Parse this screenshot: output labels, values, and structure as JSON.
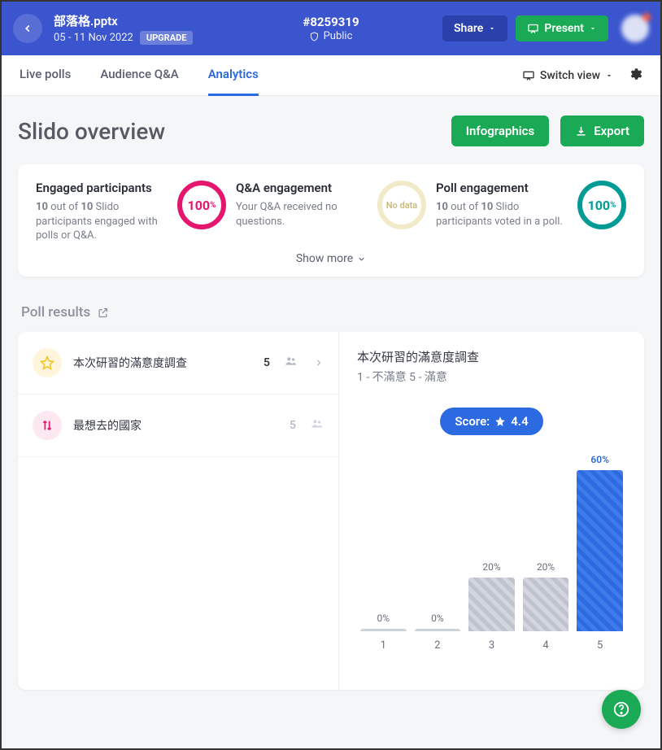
{
  "header": {
    "file_title": "部落格.pptx",
    "date_range": "05 - 11 Nov 2022",
    "upgrade_label": "UPGRADE",
    "event_id": "#8259319",
    "visibility": "Public",
    "share_label": "Share",
    "present_label": "Present"
  },
  "tabs": {
    "live_polls": "Live polls",
    "audience_qa": "Audience Q&A",
    "analytics": "Analytics",
    "switch_view": "Switch view"
  },
  "page": {
    "title": "Slido overview",
    "infographics_label": "Infographics",
    "export_label": "Export"
  },
  "overview": {
    "engaged": {
      "title": "Engaged participants",
      "desc_pre": "10",
      "desc_mid": " out of ",
      "desc_bold2": "10",
      "desc_post": " Slido participants engaged with polls or Q&A.",
      "ring": "100",
      "ring_unit": "%"
    },
    "qa": {
      "title": "Q&A engagement",
      "desc": "Your Q&A received no questions.",
      "ring": "No data"
    },
    "poll": {
      "title": "Poll engagement",
      "desc_pre": "10",
      "desc_mid": " out of ",
      "desc_bold2": "10",
      "desc_post": " Slido participants voted in a poll.",
      "ring": "100",
      "ring_unit": "%"
    },
    "show_more": "Show more"
  },
  "poll_results": {
    "header": "Poll results",
    "items": [
      {
        "name": "本次研習的滿意度調查",
        "count": "5"
      },
      {
        "name": "最想去的國家",
        "count": "5"
      }
    ],
    "detail": {
      "title": "本次研習的滿意度調查",
      "subtitle": "1 - 不滿意   5 - 滿意",
      "score_label": "Score:",
      "score_value": "4.4"
    }
  },
  "chart_data": {
    "type": "bar",
    "categories": [
      "1",
      "2",
      "3",
      "4",
      "5"
    ],
    "values": [
      0,
      0,
      20,
      20,
      60
    ],
    "value_labels": [
      "0%",
      "0%",
      "20%",
      "20%",
      "60%"
    ],
    "title": "本次研習的滿意度調查",
    "xlabel": "",
    "ylabel": "",
    "ylim": [
      0,
      60
    ],
    "highlight_index": 4
  }
}
